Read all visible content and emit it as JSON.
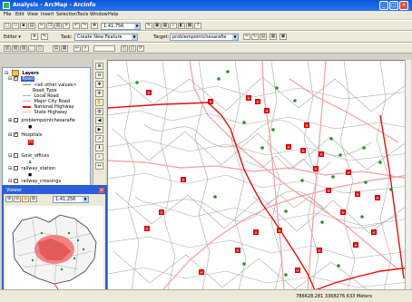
{
  "app": {
    "title": "Analysis - ArcMap - ArcInfo"
  },
  "window_buttons": [
    "_",
    "□",
    "×"
  ],
  "menus": [
    "File",
    "Edit",
    "View",
    "Insert",
    "Selection",
    "Tools",
    "Window",
    "Help"
  ],
  "toolbar": {
    "scale_value": "1:41,756"
  },
  "editor": {
    "label": "Editor ▾",
    "task_label": "Task:",
    "task_value": "Create New Feature",
    "target_label": "Target:",
    "target_value": "problempointchesarafie"
  },
  "toc": {
    "root_label": "Layers",
    "road_layer": "Road",
    "road_legend": [
      "<all other values>",
      "Road_Type",
      "Local Road",
      "Major City Road",
      "National Highway",
      "State Highway"
    ],
    "road_colors": [
      "#888888",
      "#ffffff",
      "#b0b0b0",
      "#f0a0a0",
      "#e01010",
      "#f0c080"
    ],
    "other_layers": [
      "problempointchesarafie",
      "Hospitals",
      "Govt_offices",
      "railway_station",
      "railway_crossings"
    ]
  },
  "viewer": {
    "title": "Viewer",
    "scale": "1:41,256"
  },
  "status": {
    "coords": "786628.281  3368276.633 Meters"
  },
  "colors": {
    "titlebar": "#0a57d6",
    "local_road": "#b0b0b0",
    "major_road": "#f0a0a0",
    "national_highway": "#e01010",
    "hospital_symbol": "#d40000",
    "govt_symbol": "#2f8f2f",
    "viewer_fill": "#f07070"
  }
}
